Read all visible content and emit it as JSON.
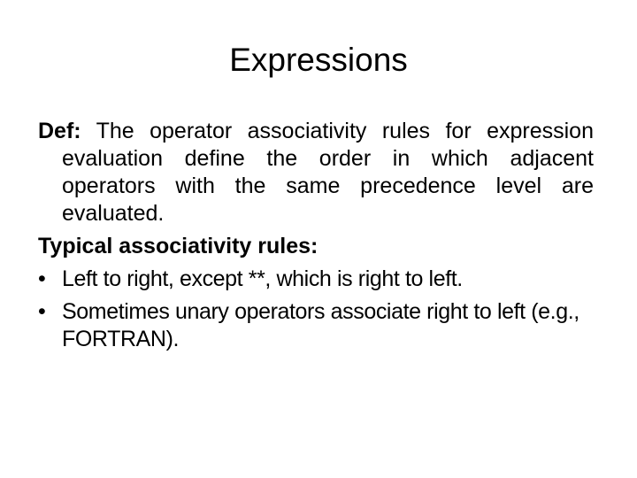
{
  "slide": {
    "title": "Expressions",
    "definition": {
      "label": "Def:",
      "text": " The operator associativity rules for expression evaluation define the order in which adjacent operators with the same precedence level are evaluated."
    },
    "heading": "Typical associativity rules:",
    "bullets": [
      {
        "marker": "•",
        "text": "Left to right, except **, which is right to left."
      },
      {
        "marker": "•",
        "text": "Sometimes unary operators associate right to left (e.g., FORTRAN)."
      }
    ]
  }
}
